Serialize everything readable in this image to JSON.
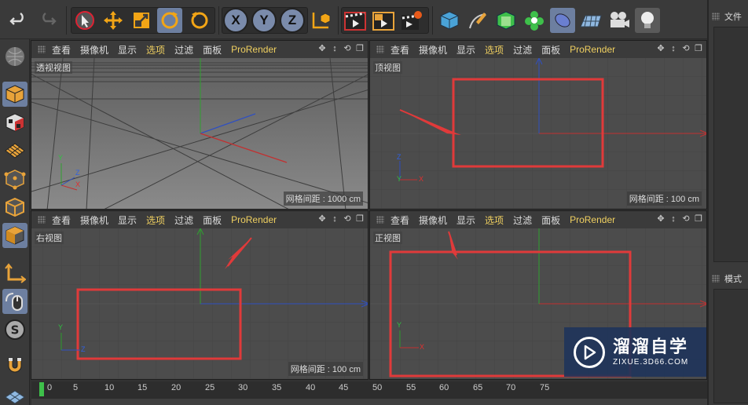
{
  "toolbar": {
    "buttons": [
      "undo",
      "redo",
      "live-select",
      "move",
      "scale",
      "rotate",
      "recent-tool"
    ],
    "axes": [
      "X",
      "Y",
      "Z"
    ]
  },
  "viewports": [
    {
      "id": "perspective",
      "title": "透视视图",
      "grid_info": "网格间距 : 1000 cm"
    },
    {
      "id": "top",
      "title": "顶视图",
      "grid_info": "网格间距 : 100 cm"
    },
    {
      "id": "right",
      "title": "右视图",
      "grid_info": "网格间距 : 100 cm"
    },
    {
      "id": "front",
      "title": "正视图",
      "grid_info": ""
    }
  ],
  "viewport_menu": [
    "查看",
    "摄像机",
    "显示",
    "选项",
    "过滤",
    "面板",
    "ProRender"
  ],
  "viewport_menu_active": "选项",
  "axis_gizmo": {
    "x": "X",
    "y": "Y",
    "z": "Z"
  },
  "right_panel": {
    "top_label": "文件",
    "bottom_label": "模式"
  },
  "timeline": {
    "marks": [
      "0",
      "5",
      "10",
      "15",
      "20",
      "25",
      "30",
      "35",
      "40",
      "45",
      "50",
      "55",
      "60",
      "65",
      "70",
      "75"
    ],
    "current_frame": 0
  },
  "watermark": {
    "main": "溜溜自学",
    "sub": "ZIXUE.3D66.COM"
  },
  "colors": {
    "highlight_rect": "#e03a3a",
    "axis_x": "#c23030",
    "axis_y": "#30a030",
    "axis_z": "#3050c0",
    "active_menu": "#f0d060"
  }
}
